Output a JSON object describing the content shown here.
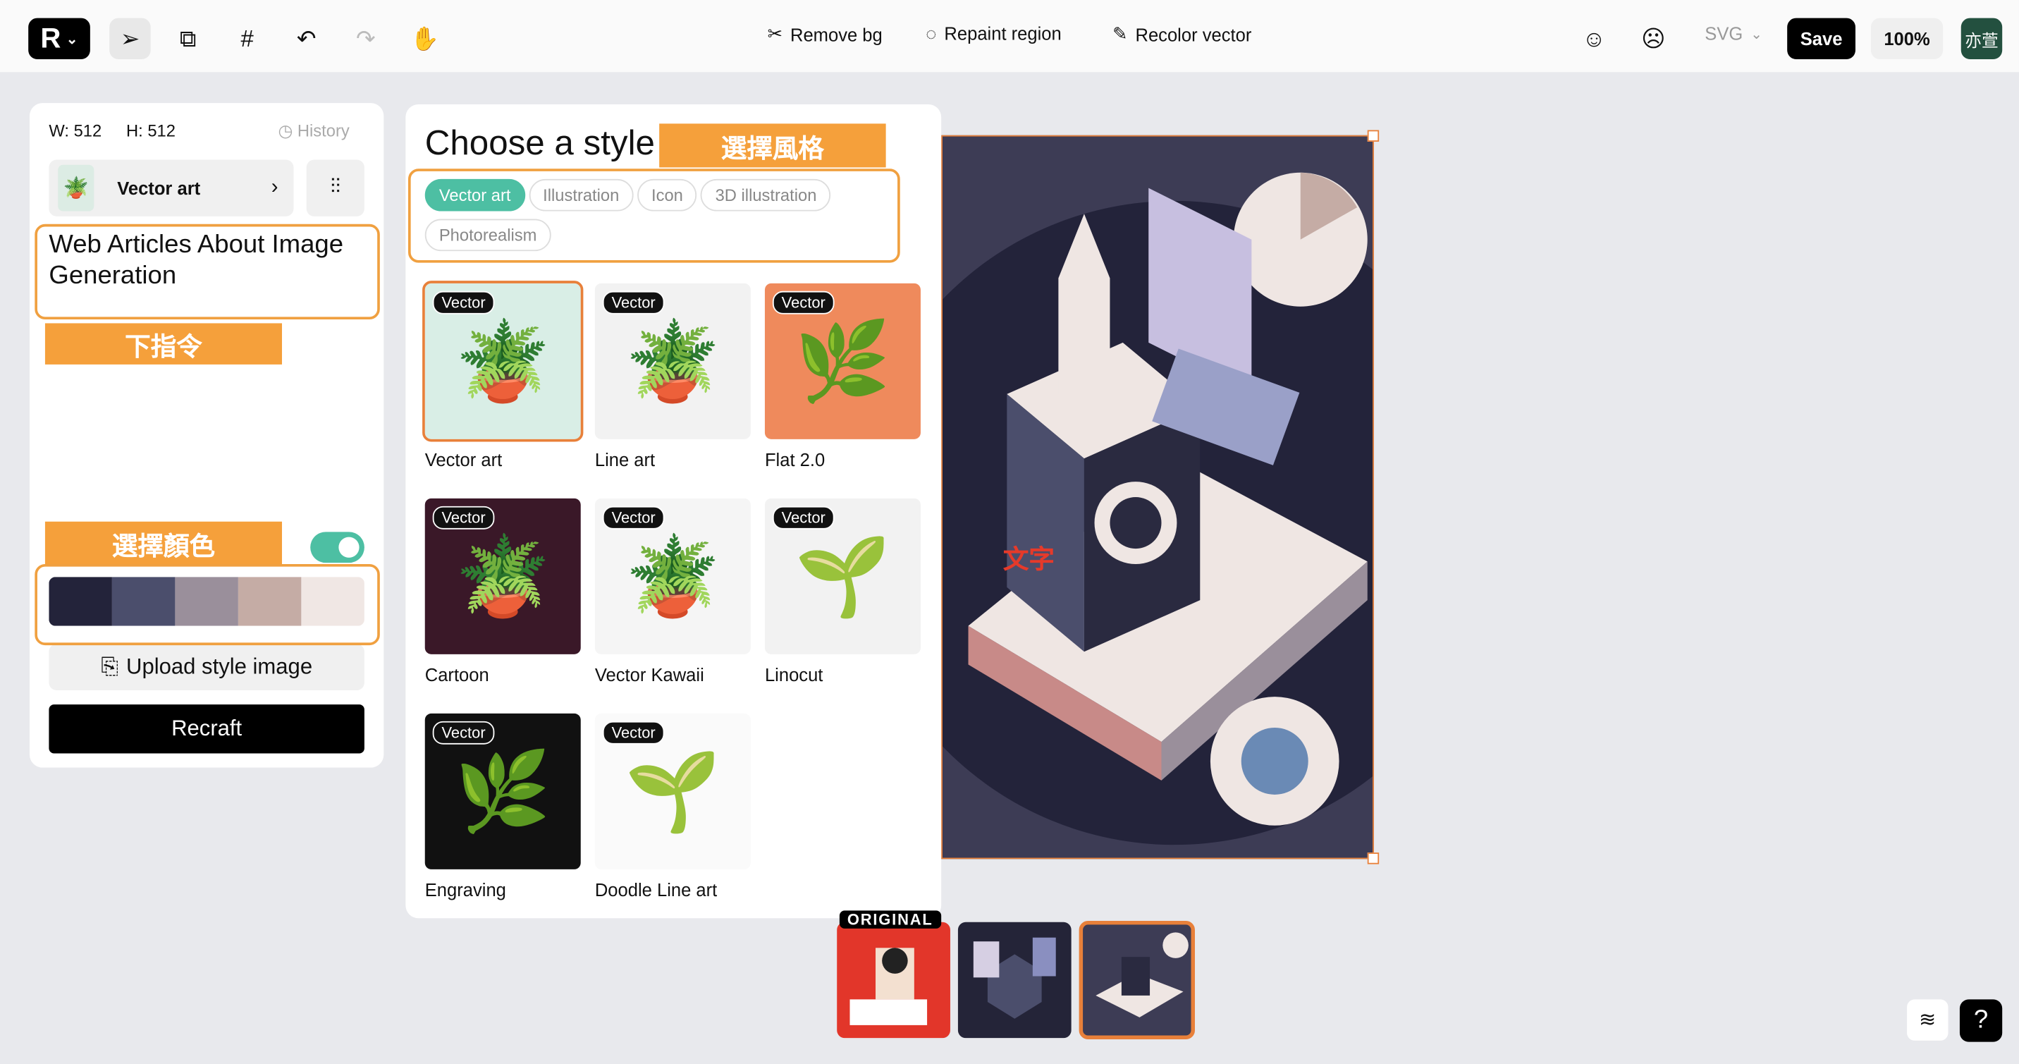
{
  "topbar": {
    "logo": "R",
    "tools": [
      {
        "label": "Remove bg",
        "icon": "scissors-icon"
      },
      {
        "label": "Repaint region",
        "icon": "lasso-icon"
      },
      {
        "label": "Recolor vector",
        "icon": "recolor-icon"
      }
    ],
    "format": "SVG",
    "save": "Save",
    "zoom": "100%",
    "avatar": "亦萱"
  },
  "left": {
    "width": "W: 512",
    "height": "H: 512",
    "history": "History",
    "model": "Vector art",
    "prompt": "Web Articles About Image Generation",
    "label_prompt": "下指令",
    "label_color": "選擇顏色",
    "palette": [
      "#23233a",
      "#4b4e6c",
      "#9a8f9b",
      "#c5aca5",
      "#f0e7e4"
    ],
    "palette_enabled": true,
    "upload": "Upload style image",
    "recraft": "Recraft"
  },
  "styles": {
    "title": "Choose a style",
    "label": "選擇風格",
    "chips": [
      "Vector art",
      "Illustration",
      "Icon",
      "3D illustration",
      "Photorealism"
    ],
    "active_chip": "Vector art",
    "badge": "Vector",
    "cards": [
      "Vector art",
      "Line art",
      "Flat 2.0",
      "Cartoon",
      "Vector Kawaii",
      "Linocut",
      "Engraving",
      "Doodle Line art"
    ]
  },
  "canvas": {
    "annotation": "文字"
  },
  "history": {
    "original_label": "ORIGINAL"
  },
  "help": "?"
}
